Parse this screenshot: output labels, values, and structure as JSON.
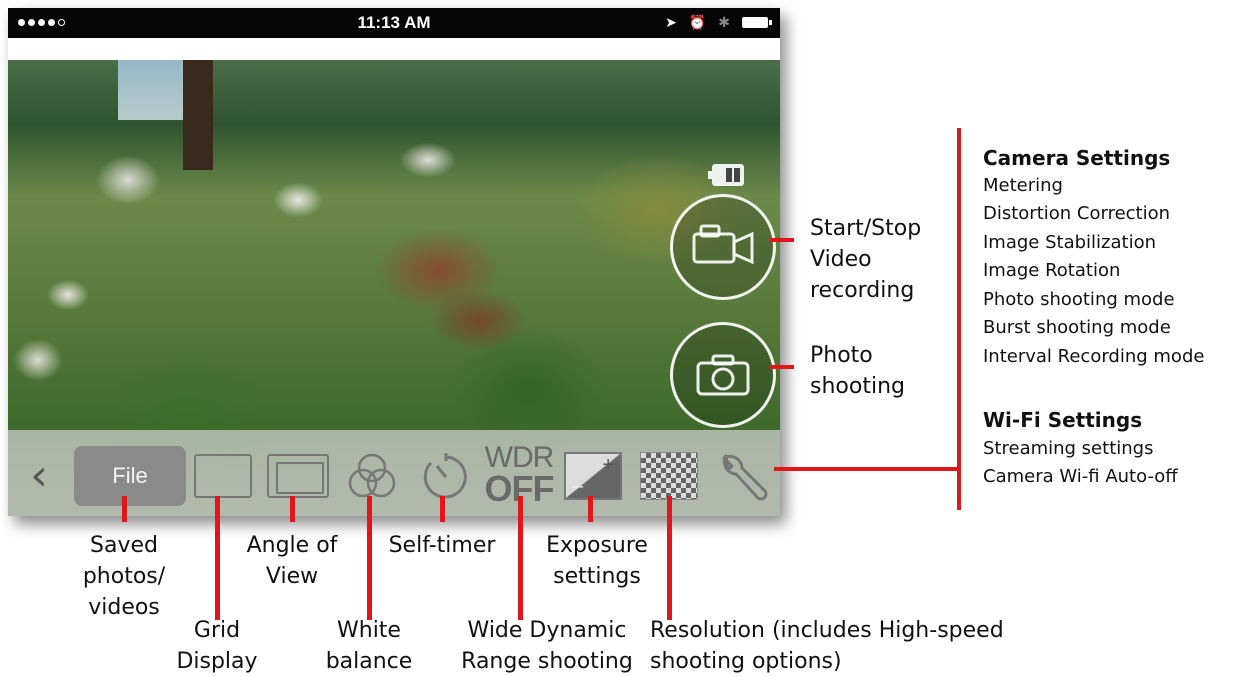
{
  "statusbar": {
    "time": "11:13 AM",
    "signal_dots": 5,
    "icons": [
      "location-icon",
      "alarm-icon",
      "bluetooth-icon",
      "battery-icon"
    ]
  },
  "toolbar": {
    "file_label": "File",
    "wdr_top": "WDR",
    "wdr_bottom": "OFF"
  },
  "callouts": {
    "saved": "Saved\nphotos/\nvideos",
    "grid": "Grid\nDisplay",
    "angle": "Angle of\nView",
    "white_balance": "White\nbalance",
    "self_timer": "Self-timer",
    "wdr": "Wide Dynamic\nRange shooting",
    "exposure": "Exposure\nsettings",
    "resolution": "Resolution (includes High-speed\nshooting options)",
    "video": "Start/Stop\nVideo\nrecording",
    "photo": "Photo\nshooting"
  },
  "settings_panel": {
    "camera_title": "Camera Settings",
    "camera_items": [
      "Metering",
      "Distortion Correction",
      "Image Stabilization",
      "Image Rotation",
      "Photo shooting mode",
      "Burst shooting mode",
      "Interval Recording mode"
    ],
    "wifi_title": "Wi-Fi Settings",
    "wifi_items": [
      "Streaming settings",
      "Camera Wi-fi Auto-off"
    ]
  },
  "colors": {
    "callout_red": "#e0161b",
    "statusbar": "#050505",
    "toolbar_bg": "#d2d2d2",
    "file_button": "#8a8a8a"
  }
}
